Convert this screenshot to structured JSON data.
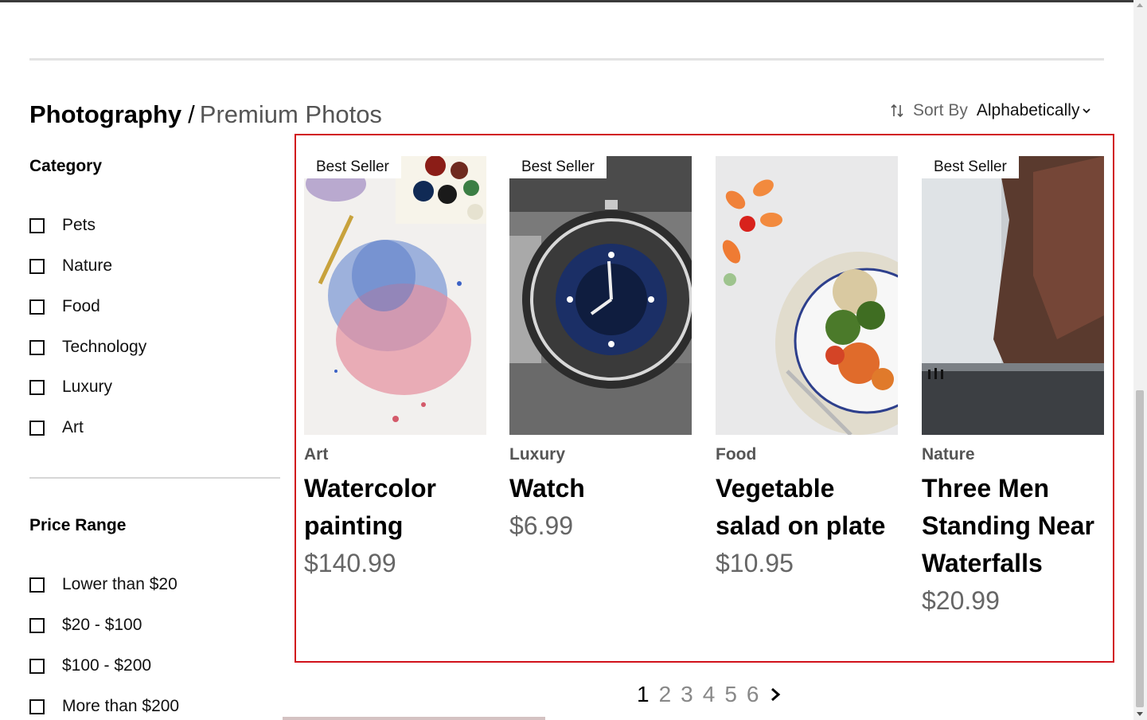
{
  "breadcrumb": {
    "main": "Photography",
    "separator": "/",
    "sub": "Premium Photos"
  },
  "sort": {
    "label": "Sort By",
    "value": "Alphabetically",
    "icon": "sort-arrows-icon"
  },
  "filters": {
    "category": {
      "heading": "Category",
      "options": [
        "Pets",
        "Nature",
        "Food",
        "Technology",
        "Luxury",
        "Art"
      ]
    },
    "price_range": {
      "heading": "Price Range",
      "options": [
        "Lower than $20",
        "$20 - $100",
        "$100 - $200",
        "More than $200"
      ]
    }
  },
  "products": [
    {
      "badge": "Best Seller",
      "category": "Art",
      "title": "Watercolor painting",
      "price": "$140.99"
    },
    {
      "badge": "Best Seller",
      "category": "Luxury",
      "title": "Watch",
      "price": "$6.99"
    },
    {
      "badge": "",
      "category": "Food",
      "title": "Vegetable salad on plate",
      "price": "$10.95"
    },
    {
      "badge": "Best Seller",
      "category": "Nature",
      "title": "Three Men Standing Near Waterfalls",
      "price": "$20.99"
    }
  ],
  "pagination": {
    "pages": [
      "1",
      "2",
      "3",
      "4",
      "5",
      "6"
    ],
    "current": "1",
    "next_icon": "chevron-right-icon"
  },
  "colors": {
    "highlight_border": "#d1121b",
    "muted_text": "#666666"
  }
}
